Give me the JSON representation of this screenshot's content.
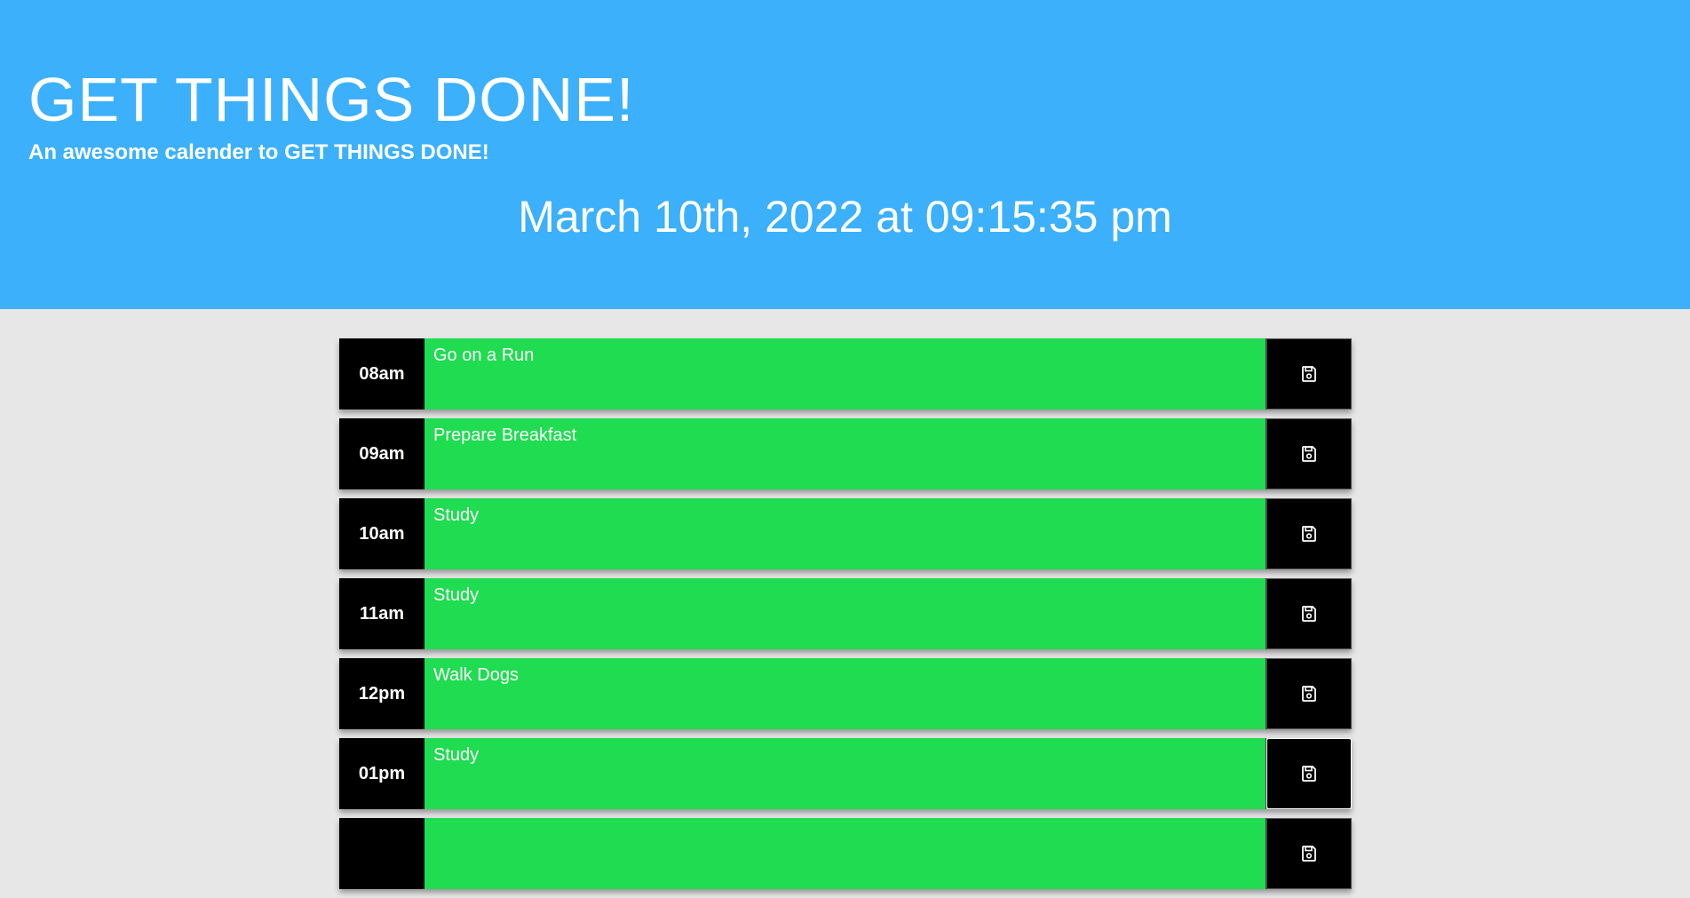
{
  "header": {
    "title": "GET THINGS DONE!",
    "tagline": "An awesome calender to GET THINGS DONE!",
    "current_day": "March 10th, 2022 at 09:15:35 pm"
  },
  "colors": {
    "header_bg": "#3cb0fb",
    "page_bg": "#e8e7e7",
    "future_block": "#1fdc51",
    "hour_bg": "#000000"
  },
  "time_blocks": [
    {
      "hour": "08am",
      "task": "Go on a Run",
      "save_icon": "floppy-disk-icon"
    },
    {
      "hour": "09am",
      "task": "Prepare Breakfast",
      "save_icon": "floppy-disk-icon"
    },
    {
      "hour": "10am",
      "task": "Study",
      "save_icon": "floppy-disk-icon"
    },
    {
      "hour": "11am",
      "task": "Study",
      "save_icon": "floppy-disk-icon"
    },
    {
      "hour": "12pm",
      "task": "Walk Dogs",
      "save_icon": "floppy-disk-icon"
    },
    {
      "hour": "01pm",
      "task": "Study",
      "save_icon": "floppy-disk-icon"
    },
    {
      "hour": "",
      "task": "",
      "save_icon": "floppy-disk-icon"
    }
  ]
}
